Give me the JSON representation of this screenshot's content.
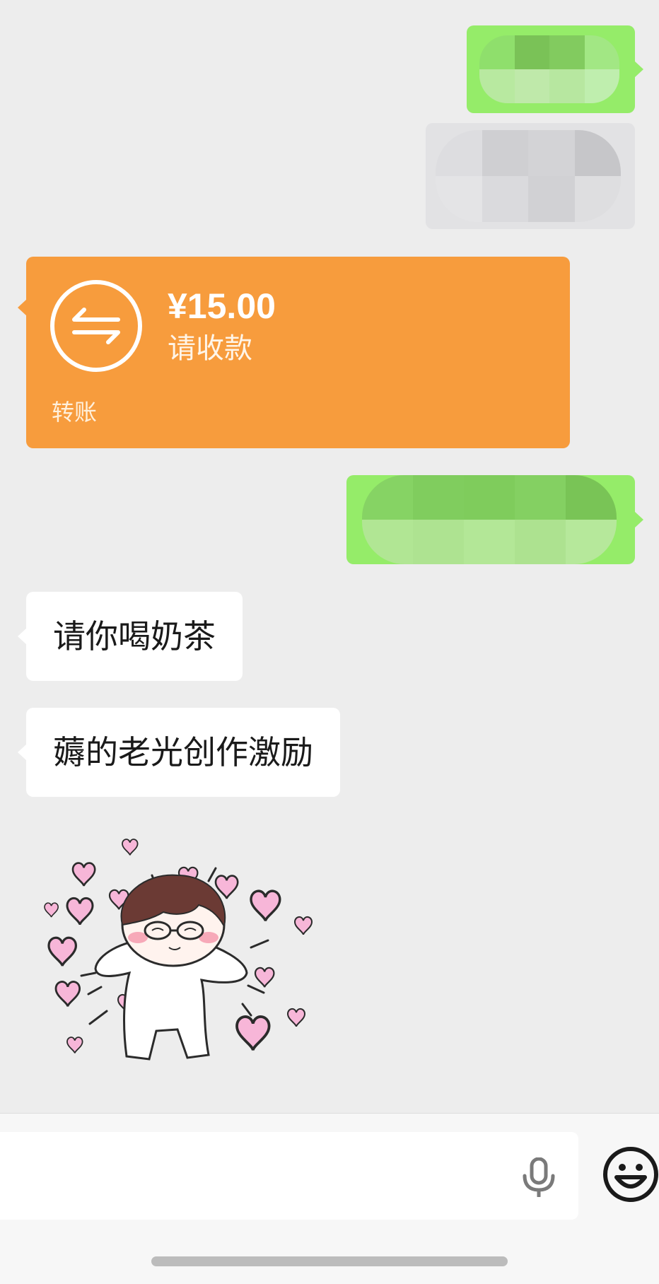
{
  "conversation": {
    "messages": [
      {
        "type": "redacted",
        "side": "out"
      },
      {
        "type": "redacted",
        "side": "out"
      },
      {
        "type": "transfer",
        "side": "in",
        "amount": "¥15.00",
        "status": "请收款",
        "label": "转账"
      },
      {
        "type": "redacted",
        "side": "out"
      },
      {
        "type": "text",
        "side": "in",
        "text": "请你喝奶茶"
      },
      {
        "type": "text",
        "side": "in",
        "text": "薅的老光创作激励"
      },
      {
        "type": "sticker",
        "side": "in",
        "icon": "hugging-boy-hearts-sticker"
      }
    ]
  },
  "input_bar": {
    "voice_icon": "microphone-icon",
    "emoji_icon": "smiley-face-icon"
  },
  "colors": {
    "background": "#ededed",
    "outgoing_bubble": "#95ec69",
    "incoming_bubble": "#ffffff",
    "transfer_card": "#f79c3d"
  }
}
